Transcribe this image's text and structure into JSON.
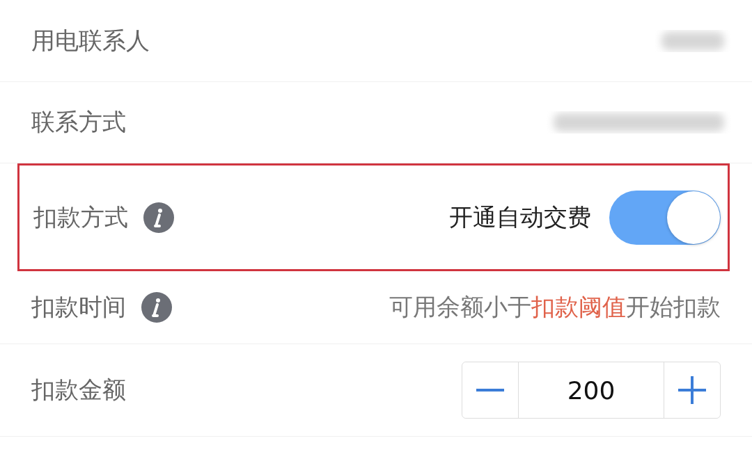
{
  "rows": [
    {
      "kind": "redacted",
      "label": "用电联系人",
      "info": false,
      "highlighted": false
    },
    {
      "kind": "redacted",
      "label": "联系方式",
      "info": false,
      "highlighted": false
    },
    {
      "kind": "toggle",
      "label": "扣款方式",
      "info": true,
      "highlighted": true,
      "toggle_label": "开通自动交费",
      "on": true
    },
    {
      "kind": "note",
      "label": "扣款时间",
      "info": true,
      "highlighted": false,
      "value_parts": [
        {
          "text": "可用余额小于",
          "emphasis": false
        },
        {
          "text": "扣款阈值",
          "emphasis": true
        },
        {
          "text": "开始扣款",
          "emphasis": false
        }
      ]
    },
    {
      "kind": "stepper",
      "label": "扣款金额",
      "info": false,
      "highlighted": false,
      "value": "200"
    }
  ]
}
